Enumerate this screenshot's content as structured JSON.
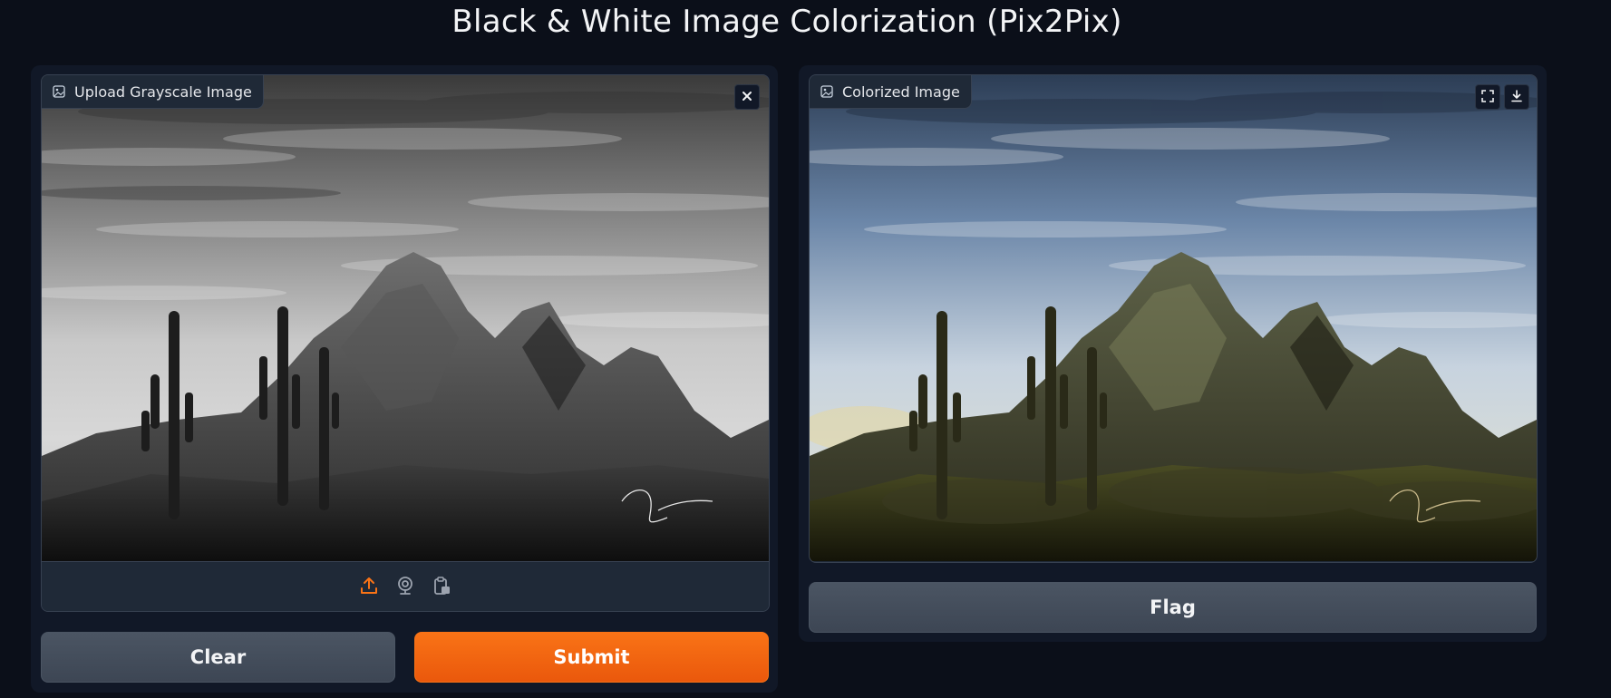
{
  "page": {
    "title": "Black & White Image Colorization (Pix2Pix)"
  },
  "input_panel": {
    "label": "Upload Grayscale Image",
    "label_icon": "image-icon",
    "clear_image_icon": "close-icon",
    "sources": [
      {
        "name": "upload-icon",
        "active": true
      },
      {
        "name": "webcam-icon",
        "active": false
      },
      {
        "name": "clipboard-icon",
        "active": false
      }
    ]
  },
  "output_panel": {
    "label": "Colorized Image",
    "label_icon": "image-icon",
    "actions": [
      "fullscreen-icon",
      "download-icon"
    ]
  },
  "buttons": {
    "clear_label": "Clear",
    "submit_label": "Submit",
    "flag_label": "Flag"
  },
  "colors": {
    "background": "#0b0f19",
    "panel": "#111827",
    "block": "#1f2937",
    "primary": "#f97316",
    "secondary": "#4b5563",
    "active_source": "#f97316"
  }
}
